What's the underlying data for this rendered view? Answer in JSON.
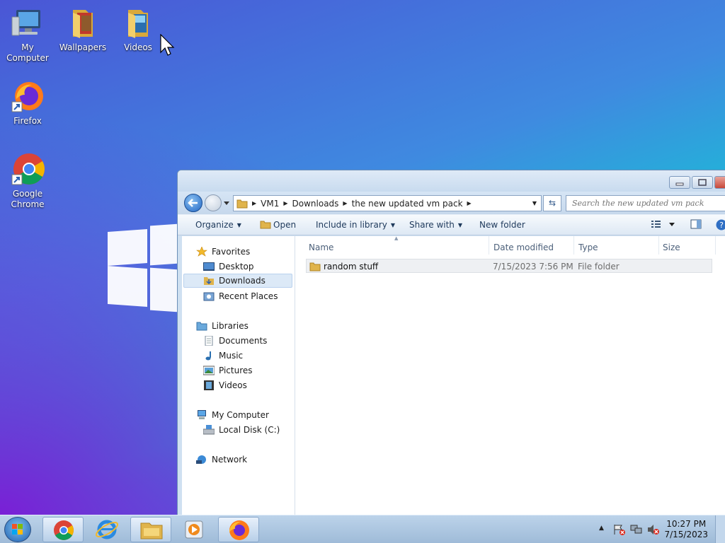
{
  "desktop": {
    "icons": [
      {
        "label": "My Computer"
      },
      {
        "label": "Wallpapers"
      },
      {
        "label": "Videos"
      },
      {
        "label": "Firefox"
      },
      {
        "label": "Google Chrome"
      }
    ]
  },
  "explorer": {
    "breadcrumb": [
      "VM1",
      "Downloads",
      "the new updated vm pack"
    ],
    "search_placeholder": "Search the new updated vm pack",
    "toolbar": {
      "organize": "Organize",
      "open": "Open",
      "include_in_library": "Include in library",
      "share_with": "Share with",
      "new_folder": "New folder"
    },
    "nav": {
      "favorites": "Favorites",
      "desktop": "Desktop",
      "downloads": "Downloads",
      "recent_places": "Recent Places",
      "libraries": "Libraries",
      "documents": "Documents",
      "music": "Music",
      "pictures": "Pictures",
      "videos": "Videos",
      "my_computer": "My Computer",
      "local_disk": "Local Disk (C:)",
      "network": "Network"
    },
    "columns": {
      "name": "Name",
      "date_modified": "Date modified",
      "type": "Type",
      "size": "Size"
    },
    "files": [
      {
        "name": "random stuff",
        "date_modified": "7/15/2023 7:56 PM",
        "type": "File folder",
        "size": ""
      }
    ]
  },
  "taskbar": {
    "clock_time": "10:27 PM",
    "clock_date": "7/15/2023"
  }
}
